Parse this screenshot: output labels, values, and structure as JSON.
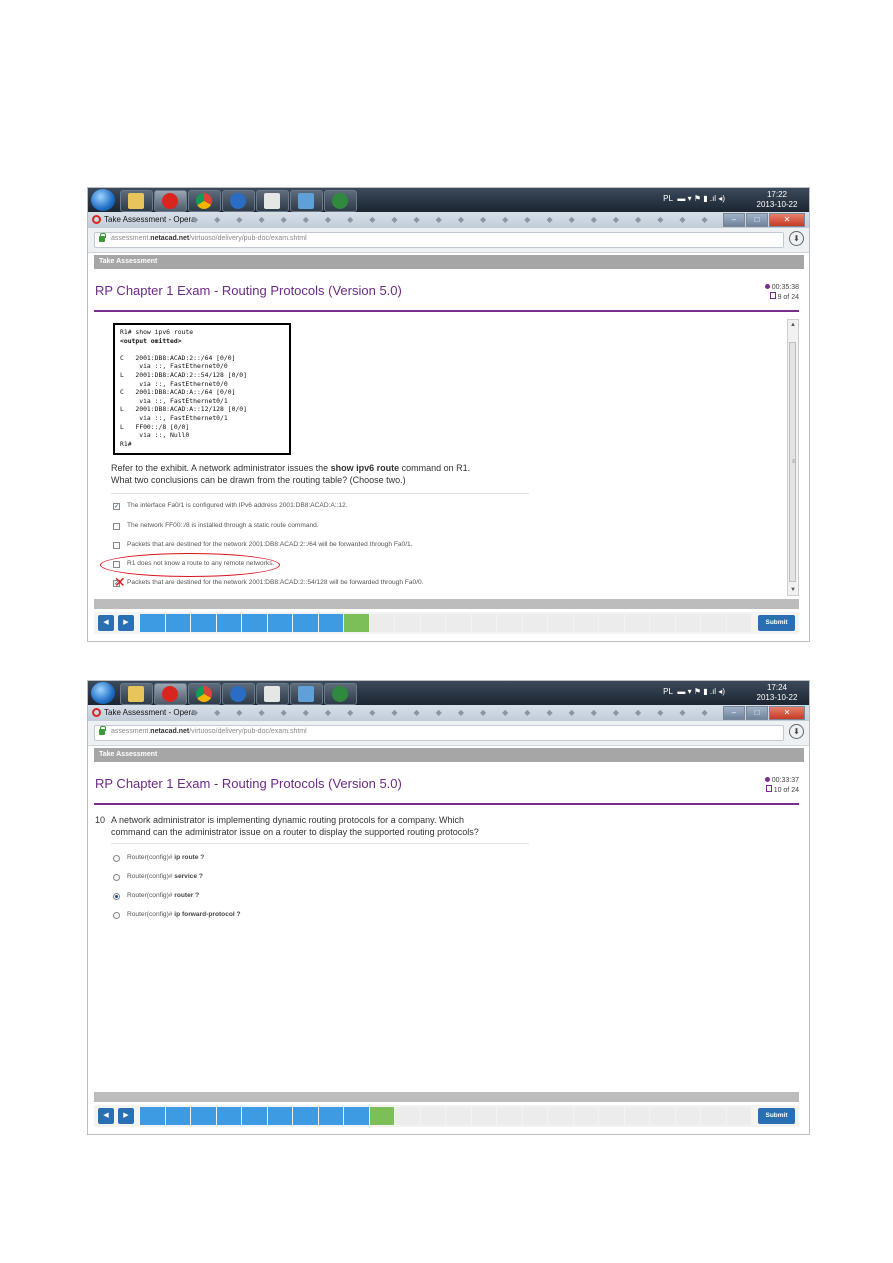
{
  "browser": {
    "window_title": "Take Assessment - Opera",
    "url_prefix": "assessment.",
    "url_domain": "netacad.net",
    "url_path": "/virtuoso/delivery/pub-doc/exam.shtml"
  },
  "taskbar": {
    "lang": "PL"
  },
  "page": {
    "header": "Take Assessment",
    "exam_title": "RP Chapter 1 Exam - Routing Protocols (Version 5.0)",
    "submit_label": "Submit",
    "prev_icon": "chevron-left-icon",
    "next_icon": "chevron-right-icon"
  },
  "shot1": {
    "clock_time": "17:22",
    "clock_date": "2013-10-22",
    "timer": "00:35:38",
    "progress": "9 of 24",
    "exhibit_lines": [
      "R1# show ipv6 route",
      "<output omitted>",
      "",
      "C   2001:DB8:ACAD:2::/64 [0/0]",
      "     via ::, FastEthernet0/0",
      "L   2001:DB8:ACAD:2::54/128 [0/0]",
      "     via ::, FastEthernet0/0",
      "C   2001:DB8:ACAD:A::/64 [0/0]",
      "     via ::, FastEthernet0/1",
      "L   2001:DB8:ACAD:A::12/128 [0/0]",
      "     via ::, FastEthernet0/1",
      "L   FF00::/8 [0/0]",
      "     via ::, Null0",
      "R1#"
    ],
    "question_line1_a": "Refer to the exhibit. A network administrator issues the ",
    "question_line1_b": "show ipv6 route",
    "question_line1_c": " command on R1.",
    "question_line2": "What two conclusions can be drawn from the routing table? (Choose two.)",
    "options": [
      {
        "label": "The interface Fa0/1 is configured with IPv6 address 2001:DB8:ACAD:A::12.",
        "checked": true
      },
      {
        "label": "The network FF00::/8 is installed through a static route command.",
        "checked": false
      },
      {
        "label": "Packets that are destined for the network 2001:DB8:ACAD:2::/64 will be forwarded through Fa0/1.",
        "checked": false
      },
      {
        "label": "R1 does not know a route to any remote networks.",
        "checked": false
      },
      {
        "label": "Packets that are destined for the network 2001:DB8:ACAD:2::54/128 will be forwarded through Fa0/0.",
        "checked": true
      }
    ],
    "pager_done": 8,
    "pager_current": 9,
    "pager_total": 24
  },
  "shot2": {
    "clock_time": "17:24",
    "clock_date": "2013-10-22",
    "timer": "00:33:37",
    "progress": "10 of 24",
    "question_number": "10",
    "question_line1": "A network administrator is implementing dynamic routing protocols for a company. Which",
    "question_line2": "command can the administrator issue on a router to display the supported routing protocols?",
    "options": [
      {
        "prefix": "Router(config)# ",
        "command": "ip route ?",
        "selected": false
      },
      {
        "prefix": "Router(config)# ",
        "command": "service ?",
        "selected": false
      },
      {
        "prefix": "Router(config)# ",
        "command": "router ?",
        "selected": true
      },
      {
        "prefix": "Router(config)# ",
        "command": "ip forward-protocol ?",
        "selected": false
      }
    ],
    "pager_done": 9,
    "pager_current": 10,
    "pager_total": 24
  }
}
